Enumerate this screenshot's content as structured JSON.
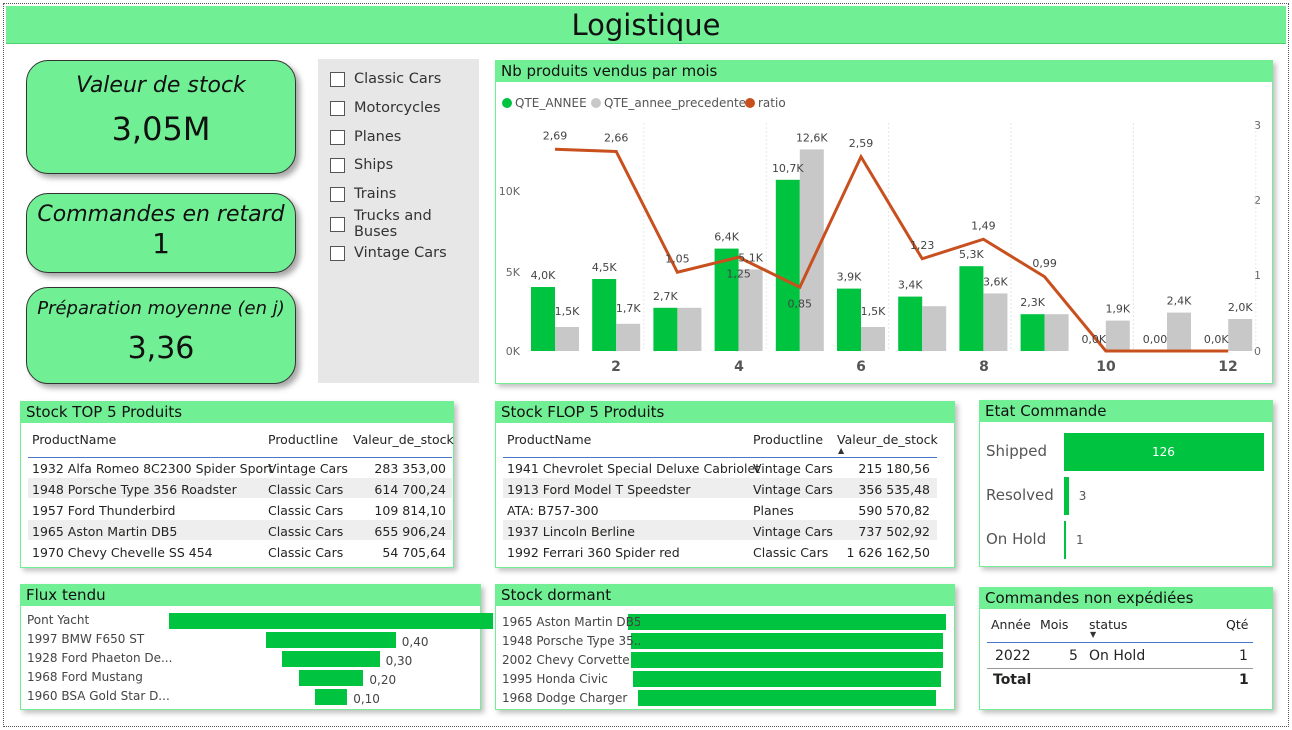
{
  "page_title": "Logistique",
  "kpis": [
    {
      "label": "Valeur de stock",
      "value": "3,05M"
    },
    {
      "label": "Commandes en retard",
      "value": "1"
    },
    {
      "label": "Préparation moyenne (en j)",
      "value": "3,36"
    }
  ],
  "slicer": {
    "items": [
      "Classic Cars",
      "Motorcycles",
      "Planes",
      "Ships",
      "Trains",
      "Trucks and Buses",
      "Vintage Cars"
    ]
  },
  "monthly_chart": {
    "title": "Nb produits vendus par mois",
    "legend": [
      {
        "label": "QTE_ANNEE",
        "color": "#00c340"
      },
      {
        "label": "QTE_annee_precedente",
        "color": "#c8c8c8"
      },
      {
        "label": "ratio",
        "color": "#c8501e"
      }
    ],
    "y_left_ticks": [
      "0K",
      "5K",
      "10K"
    ],
    "y_right_ticks": [
      "0",
      "1",
      "2",
      "3"
    ],
    "x_ticks": [
      "2",
      "4",
      "6",
      "8",
      "10",
      "12"
    ]
  },
  "chart_data": {
    "type": "bar",
    "title": "Nb produits vendus par mois",
    "x": [
      1,
      2,
      3,
      4,
      5,
      6,
      7,
      8,
      9,
      10,
      11,
      12
    ],
    "series": [
      {
        "name": "QTE_ANNEE",
        "type": "bar",
        "axis": "left",
        "values": [
          4000,
          4500,
          2700,
          6400,
          10700,
          3900,
          3400,
          5300,
          2300,
          0,
          0,
          0
        ],
        "labels": [
          "4,0K",
          "4,5K",
          "2,7K",
          "6,4K",
          "10,7K",
          "3,9K",
          "3,4K",
          "5,3K",
          "2,3K",
          "0,0K",
          "0,00",
          "0,0K"
        ]
      },
      {
        "name": "QTE_annee_precedente",
        "type": "bar",
        "axis": "left",
        "values": [
          1500,
          1700,
          2700,
          5100,
          12600,
          1500,
          2800,
          3600,
          2300,
          1900,
          2400,
          2000
        ],
        "labels": [
          "1,5K",
          "1,7K",
          "",
          "5,1K",
          "12,6K",
          "1,5K",
          "",
          "3,6K",
          "",
          "1,9K",
          "2,4K",
          "2,0K"
        ]
      },
      {
        "name": "ratio",
        "type": "line",
        "axis": "right",
        "values": [
          2.69,
          2.66,
          1.05,
          1.25,
          0.85,
          2.59,
          1.23,
          1.49,
          0.99,
          0,
          0,
          0
        ],
        "labels": [
          "2,69",
          "2,66",
          "1,05",
          "1,25",
          "0,85",
          "2,59",
          "1,23",
          "1,49",
          "0,99",
          "",
          "",
          ""
        ]
      }
    ],
    "ylim_left": [
      0,
      14000
    ],
    "ylim_right": [
      0,
      3
    ],
    "legend_position": "top-left"
  },
  "top5": {
    "title": "Stock TOP 5 Produits",
    "headers": [
      "ProductName",
      "Productline",
      "Valeur_de_stock"
    ],
    "rows": [
      [
        "1932 Alfa Romeo 8C2300 Spider Sport",
        "Vintage Cars",
        "283 353,00"
      ],
      [
        "1948 Porsche Type 356 Roadster",
        "Classic Cars",
        "614 700,24"
      ],
      [
        "1957 Ford Thunderbird",
        "Classic Cars",
        "109 814,10"
      ],
      [
        "1965 Aston Martin DB5",
        "Classic Cars",
        "655 906,24"
      ],
      [
        "1970 Chevy Chevelle SS 454",
        "Classic Cars",
        "54 705,64"
      ]
    ]
  },
  "flop5": {
    "title": "Stock FLOP 5 Produits",
    "headers": [
      "ProductName",
      "Productline",
      "Valeur_de_stock"
    ],
    "rows": [
      [
        "1941 Chevrolet Special Deluxe Cabriolet",
        "Vintage Cars",
        "215 180,56"
      ],
      [
        "1913 Ford Model T Speedster",
        "Vintage Cars",
        "356 535,48"
      ],
      [
        "ATA: B757-300",
        "Planes",
        "590 570,82"
      ],
      [
        "1937 Lincoln Berline",
        "Vintage Cars",
        "737 502,92"
      ],
      [
        "1992 Ferrari 360 Spider red",
        "Classic Cars",
        "1 626 162,50"
      ]
    ]
  },
  "etat_commande": {
    "title": "Etat Commande",
    "items": [
      {
        "label": "Shipped",
        "value": 126,
        "display": "126"
      },
      {
        "label": "Resolved",
        "value": 3,
        "display": "3"
      },
      {
        "label": "On Hold",
        "value": 1,
        "display": "1"
      }
    ]
  },
  "flux_tendu": {
    "title": "Flux tendu",
    "items": [
      {
        "label": "Pont Yacht",
        "value": 1.0,
        "display": ""
      },
      {
        "label": "1997 BMW F650 ST",
        "value": 0.4,
        "display": "0,40"
      },
      {
        "label": "1928 Ford Phaeton De...",
        "value": 0.3,
        "display": "0,30"
      },
      {
        "label": "1968 Ford Mustang",
        "value": 0.2,
        "display": "0,20"
      },
      {
        "label": "1960 BSA Gold Star D...",
        "value": 0.1,
        "display": "0,10"
      }
    ]
  },
  "stock_dormant": {
    "title": "Stock dormant",
    "items": [
      {
        "label": "1965 Aston Martin DB5",
        "value": 1.0
      },
      {
        "label": "1948 Porsche Type 35...",
        "value": 0.98
      },
      {
        "label": "2002 Chevy Corvette",
        "value": 0.98
      },
      {
        "label": "1995 Honda Civic",
        "value": 0.97
      },
      {
        "label": "1968 Dodge Charger",
        "value": 0.94
      }
    ]
  },
  "non_expediees": {
    "title": "Commandes non expédiées",
    "headers": [
      "Année",
      "Mois",
      "status",
      "Qté"
    ],
    "row": [
      "2022",
      "5",
      "On Hold",
      "1"
    ],
    "total_label": "Total",
    "total_value": "1"
  }
}
